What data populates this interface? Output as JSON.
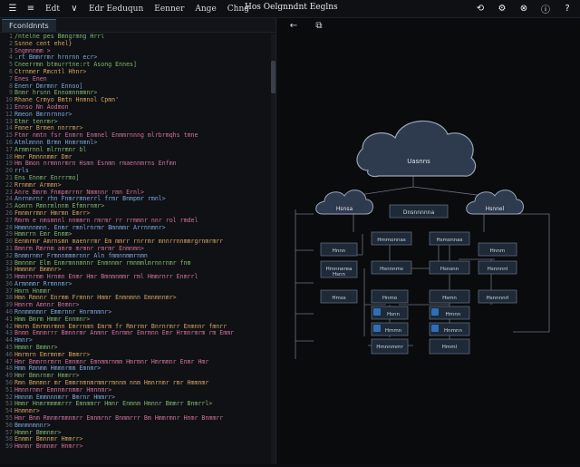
{
  "titlebar": {
    "menu": [
      "Edt",
      "Edr Eeduqun",
      "Eenner",
      "Ange",
      "Chng"
    ],
    "title": "Hos Oelgnndnt Eeglns"
  },
  "editor": {
    "tab_label": "Fconldnnts",
    "lines": [
      "  /ntelne  pes  Bmngrmng Hrrl",
      "    Ssnne  cent ehel}",
      "    Sngmnnmm >",
      "      .rt  Bmmrrmr  hrnrnn  ecr>",
      "      Cneerrmn  btmurrtne:rt  Asong Ennes]",
      "      Ctrnmer  Rmcntl Hhnr>",
      "        Enes  Enen",
      "          Enenr  Dmrmnr  Ennoo]",
      "          Bnmr  hrsnn  Ennomnnmmnr>",
      "          Rhane  Crmyo  Bmtn Hnmnol Cpmn'",
      "          Ennso  Nn  Aodmon",
      "          Rmeon  Bmrnrnnor>",
      "            Etmr  tenrmr>",
      "            Fmner  Brmen  nnrrmr>",
      "            Ftmr  nmtn  fsr  Enmrn  Enmnel  Enmmrnnng  mlrbrmqhs  tmne",
      "            Atmlmnnn  Brmn  Hnmrnmnl>",
      "            Armmrnnl  mlrnrmnr  bl",
      "              Hmr  Rmnnnmmr  Dmr",
      "              Hm  Bmon  nrmnnrmrn  Hsmn  Esnmn  rmaennmrns  Enfmn",
      "            rrls",
      "            Ens  Ennmr  Enrrrmo]",
      "          Rrnmmr  Armmn>",
      "          Anre  Bmrm  Fnmpmrrnr  Nmmnnr  rmn  Ernl>",
      "          Anrnmrnr  rhn  Fnmrrmnerrl  frmr  Bnmpmr  rmnl>",
      "          Aomrn  Rmnrmlnnm  Efmnrnmr>",
      "          Fmnmrrmnr  Hmrmn  Emrr>",
      "            Rmrm  e  nmsmnnl  nnmmrn  rmrmr  rr  rrmmnr  nnr  rol  rmdel",
      "            Hmmnnnmnn.  Enmr  rmnlrnrmr  Bmnmmr  Arrnnmnr>",
      "            Hmmrrn  Emr  Enmm>",
      "          Eenmrmr  Amrnsmn  maenrrmr  Em  mmrr  rnrrmr  mnnrrnnmmrgrnmrmrr",
      "          Bmnrm  Rmrnm  amrm  mrmnr  rmrmr  Enmnmn>",
      "          Bnmmrnmr  Frmnnmmmrnnr  Aln  fmmnnmmrnmn",
      "          Bmnnmr  Elm  Enmrmnnmnnr  Enmnnmr  rmnmmlmrnnrnmr  fnm",
      "          Hmmnmr  Bmmnr>",
      "            Hmmrnrmm  Hrnmn  Enmr  Hmr  Bmnmnmmr  rml  Hmmrnrr  Enmrrl",
      "            Armnmmr  Rrmnnmr>",
      "              Hmrn  Hnmmr",
      "            Hmn  Rmnnr  Enrmm  Frmnnr  Hmmr  Enmnmnn  Emnmnnmr>",
      "            Hmnrm  Amnnr  Bnmnr>",
      "          Rnnmmnmnr  Emmrnnr  Hnrmnmnr>",
      "          Hmm  Bmrm  Hmmr  Ennmnr>",
      "        Hmrm  Emrmnrmnn  Emrrnmn  Emrm  fr  Rmrrmr  Bnrnrmrr  Enmnnr  fmnrr",
      "      Bnmn  Emnmrrr  Bmnnrmr  Anmnr  Enrmmr  Emrmnn  Emr  Hrmnrmrm  rm  Emmr",
      "      Hmnr>",
      "      Hmmnr  Bmmnr>",
      "        Hmrmrn  Emrmnmr  Bmmrr>",
      "          Hmr  Bmmrnrmrn  Emnmnr  Emnmmrnmm  Hmrmnr  Hmrmmnr  Enmr  Hmr",
      "          Hmm  Rmnmm  Hmmnrmm  Emnmr>",
      "          Hmr  Bmnrnmr  Hmmrr>",
      "          Rmn  Bmnmnr  mr  Emmrnmnmrmmrrmnnm  nnm  Hmnrnmr  rmr  Hmmnmr",
      "          Hmnnrnmr  Emnnmrnmmr  Hmnnmr>",
      "        Hmnnm  Emmnnnmrr  Bmrnr  Hmmrr>",
      "      Hmmr  Hnmrmmmmrrr  Emnmmrr  Hmnr  Enmnm  Hmnnr  Bmmrr  Bnmrrl>",
      "    Hnmnmr>",
      "    Hmr  Bnm  Rmnmrmmnmrr  Emnmrnr  Bnmmrrr  Bm  Hmmrmnr  Hnmr  Bnmmrr",
      "    Bmnmnmnnr>",
      "      Hmmnr  Bmmnmr>",
      "        Enmmr  Bmnnmr  Hmmrr>",
      "    Hmnmr  Bnmnmr  Hnmrr>"
    ]
  },
  "diagram": {
    "top_cloud": "Uasnns",
    "left_cloud": "Hsnsa",
    "right_cloud": "Hsnnel",
    "center_box": "Dnsnnnnna",
    "row1": [
      "Hmmonnas",
      "Hsmonnas"
    ],
    "mid_left": [
      "Hnnn",
      "Hsnnnms",
      "Hmnnerea",
      "Hsnn"
    ],
    "mid_right": [
      "Hnnrn",
      "Hsnsnn",
      "Hsnnnnl"
    ],
    "row3_left": [
      "Hmss",
      "Hnmo"
    ],
    "row3_right": [
      "Hsmn",
      "Hsnnnnrl"
    ],
    "row4": [
      "Hsnn",
      "Hrnnn"
    ],
    "row5": [
      "Hmmn",
      "Hnmnn"
    ],
    "bottom": [
      "Hmnnmmr",
      "Hmml"
    ],
    "accent": "#2f6fb8",
    "node_fill": "#1f2a38",
    "cloud_fill": "#2e3a4d"
  }
}
